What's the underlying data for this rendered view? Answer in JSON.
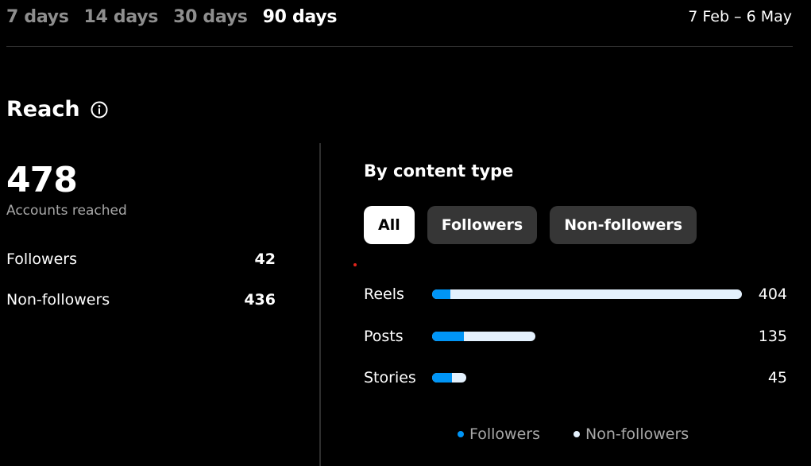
{
  "range_tabs": [
    {
      "label": "7 days"
    },
    {
      "label": "14 days"
    },
    {
      "label": "30 days"
    },
    {
      "label": "90 days",
      "active": true
    }
  ],
  "date_range": "7 Feb – 6 May",
  "reach": {
    "title": "Reach",
    "info_icon": "info-icon",
    "accounts_reached": "478",
    "accounts_reached_label": "Accounts reached",
    "followers_label": "Followers",
    "followers_value": "42",
    "non_followers_label": "Non-followers",
    "non_followers_value": "436"
  },
  "content_type": {
    "title": "By content type",
    "filters": [
      {
        "label": "All",
        "active": true
      },
      {
        "label": "Followers"
      },
      {
        "label": "Non-followers"
      }
    ],
    "rows": [
      {
        "label": "Reels",
        "value": "404",
        "total": 404,
        "followers": 24
      },
      {
        "label": "Posts",
        "value": "135",
        "total": 135,
        "followers": 41
      },
      {
        "label": "Stories",
        "value": "45",
        "total": 45,
        "followers": 26
      }
    ],
    "legend": [
      {
        "label": "Followers",
        "color": "#0095f6"
      },
      {
        "label": "Non-followers",
        "color": "#e4f1fd"
      }
    ]
  },
  "colors": {
    "followers": "#0095f6",
    "non_followers": "#e4f1fd",
    "background": "#000000",
    "accent_dot": "#e0241b"
  }
}
